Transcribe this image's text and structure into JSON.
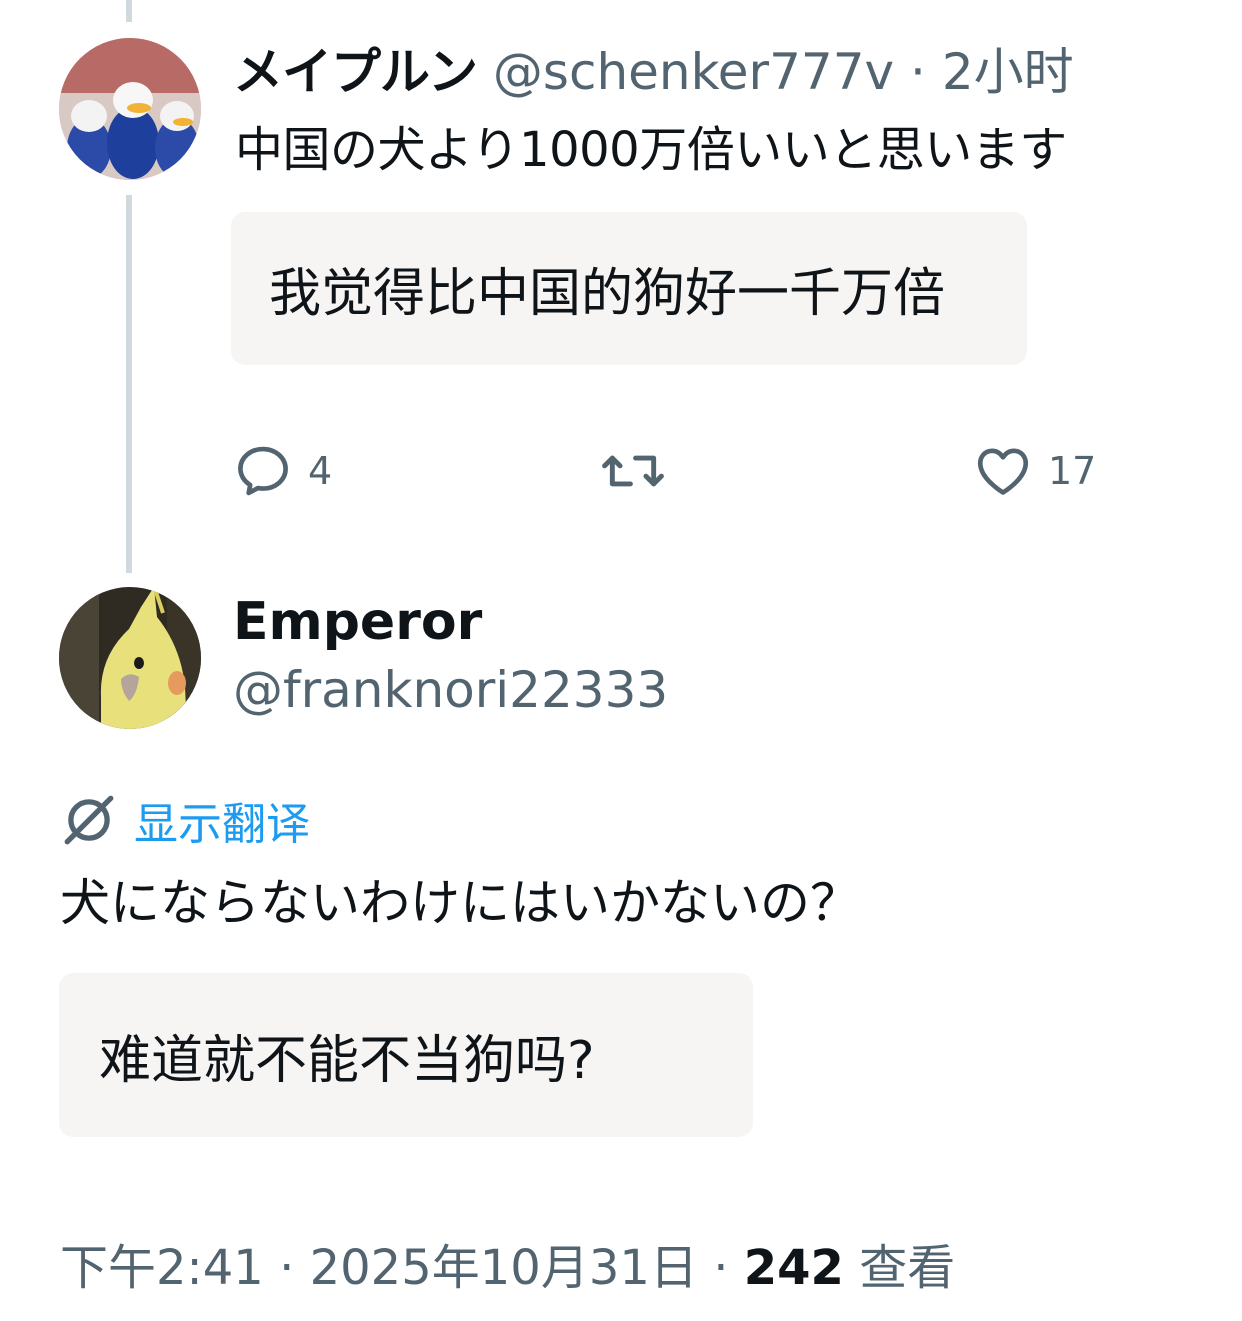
{
  "reply": {
    "display_name": "メイプルン",
    "handle": "@schenker777v",
    "separator": "·",
    "time_ago": "2小时",
    "text": "中国の犬より1000万倍いいと思います",
    "translation": "我觉得比中国的狗好一千万倍",
    "actions": {
      "reply_count": "4",
      "retweet_count": "",
      "like_count": "17"
    }
  },
  "main_post": {
    "display_name": "Emperor",
    "handle": "@franknori22333",
    "show_translation_label": "显示翻译",
    "text": "犬にならないわけにはいかないの？",
    "translation": "难道就不能不当狗吗?",
    "meta": {
      "time": "下午2:41",
      "date": "2025年10月31日",
      "separator": "·",
      "views_count": "242",
      "views_label": "查看"
    }
  },
  "colors": {
    "text_primary": "#0f1419",
    "text_secondary": "#536471",
    "link_blue": "#1d9bf0",
    "thread_line": "#cfd9de",
    "translation_bg": "#f7f4f4"
  }
}
